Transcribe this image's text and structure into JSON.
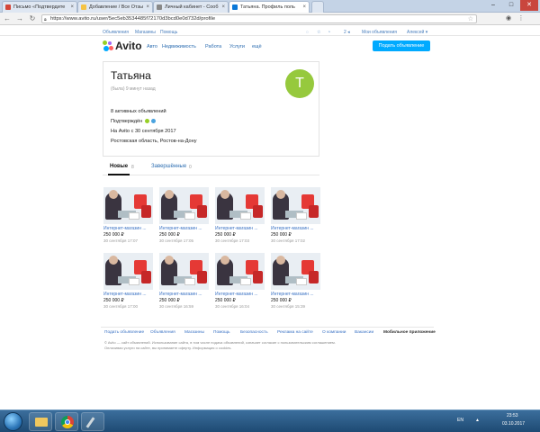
{
  "browser": {
    "tabs": [
      {
        "label": "Письмо «Подтвердите",
        "active": false,
        "favicon_color": "#d44638"
      },
      {
        "label": "Добавление / Все Отзы",
        "active": false,
        "favicon_color": "#f5c344"
      },
      {
        "label": "Личный кабинет - Сооб",
        "active": false,
        "favicon_color": "#888888"
      },
      {
        "label": "Татьяна. Профиль поль",
        "active": true,
        "favicon_color": "#0a78d8"
      }
    ],
    "url": "https://www.avito.ru/user/5ec5eb3534485f72170d3bcd0e0d732d/profile",
    "window_controls": {
      "minimize": "–",
      "maximize": "□",
      "close": "✕"
    }
  },
  "utilbar": {
    "links": [
      "Объявления",
      "Магазины",
      "Помощь"
    ],
    "right_items": [
      "2 ◂",
      "Мои объявления",
      "Алексей ▾"
    ]
  },
  "header": {
    "logo_text": "Avito",
    "nav": [
      "Авто",
      "Недвижимость",
      "Работа",
      "Услуги",
      "ещё"
    ],
    "post_button": "Подать объявление",
    "logo_colors": [
      "#97cf26",
      "#a169f7",
      "#ff6163",
      "#00aaff"
    ]
  },
  "profile": {
    "name": "Татьяна",
    "last_seen": "(была) 9 минут назад",
    "avatar_letter": "Т",
    "avatar_color": "#96c93d",
    "active_ads": "8 активных объявлений",
    "confirmed": "Подтверждён",
    "on_avito_since": "На Avito с 30 сентября 2017",
    "location": "Ростовская область, Ростов-на-Дону"
  },
  "tabs": {
    "new_label": "Новые",
    "new_count": "8",
    "finished_label": "Завершённые",
    "finished_count": "0"
  },
  "ads": [
    {
      "title": "Интернет-магазин ...",
      "price": "250 000 ₽",
      "date": "30 сентября 17:07"
    },
    {
      "title": "Интернет-магазин ...",
      "price": "250 000 ₽",
      "date": "30 сентября 17:05"
    },
    {
      "title": "Интернет-магазин ...",
      "price": "250 000 ₽",
      "date": "30 сентября 17:03"
    },
    {
      "title": "Интернет-магазин ...",
      "price": "250 000 ₽",
      "date": "30 сентября 17:02"
    },
    {
      "title": "Интернет-магазин ...",
      "price": "250 000 ₽",
      "date": "30 сентября 17:00"
    },
    {
      "title": "Интернет-магазин ...",
      "price": "250 000 ₽",
      "date": "30 сентября 16:59"
    },
    {
      "title": "Интернет-магазин ...",
      "price": "250 000 ₽",
      "date": "30 сентября 16:04"
    },
    {
      "title": "Интернет-магазин ...",
      "price": "250 000 ₽",
      "date": "30 сентября 15:39"
    }
  ],
  "footer": {
    "links": [
      "Подать объявление",
      "Объявления",
      "Магазины",
      "Помощь",
      "Безопасность",
      "Реклама на сайте",
      "О компании",
      "Вакансии",
      "Мобильное приложение"
    ],
    "copyright_1": "© Avito — сайт объявлений. Использование сайта, в том числе подача объявлений, означает согласие с пользовательским соглашением.",
    "copyright_2": "Оплачивая услуги на сайте, вы принимаете оферту. Информация о cookies."
  },
  "taskbar": {
    "lang": "EN",
    "time": "23:53",
    "date": "03.10.2017"
  }
}
